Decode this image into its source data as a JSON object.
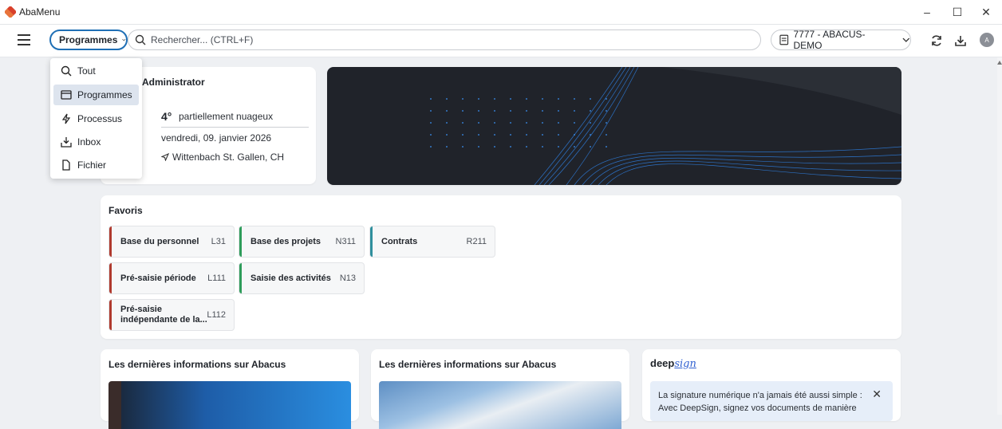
{
  "titlebar": {
    "app_title": "AbaMenu",
    "minimize": "–",
    "maximize": "☐",
    "close": "✕"
  },
  "toolbar": {
    "programmes_label": "Programmes",
    "search_placeholder": "Rechercher... (CTRL+F)",
    "company_label": "7777 - ABACUS-DEMO",
    "avatar_initial": "A"
  },
  "menu": {
    "items": [
      {
        "label": "Tout",
        "icon": "search-icon"
      },
      {
        "label": "Programmes",
        "icon": "window-icon",
        "active": true
      },
      {
        "label": "Processus",
        "icon": "bolt-icon"
      },
      {
        "label": "Inbox",
        "icon": "inbox-icon"
      },
      {
        "label": "Fichier",
        "icon": "file-icon"
      }
    ]
  },
  "welcome": {
    "name": "Administrator",
    "temperature": "4°",
    "weather": "partiellement nuageux",
    "date": "vendredi, 09. janvier 2026",
    "location": "Wittenbach St. Gallen, CH"
  },
  "favorites": {
    "title": "Favoris",
    "items": [
      {
        "label": "Base du personnel",
        "code": "L31",
        "color": "#b03a2e"
      },
      {
        "label": "Base des projets",
        "code": "N311",
        "color": "#2e9c5a"
      },
      {
        "label": "Contrats",
        "code": "R211",
        "color": "#2f8f9d"
      },
      {
        "label": "Pré-saisie période",
        "code": "L111",
        "color": "#b03a2e"
      },
      {
        "label": "Saisie des activités",
        "code": "N13",
        "color": "#2e9c5a"
      },
      {
        "label_line1": "Pré-saisie",
        "label_line2": "indépendante de la...",
        "code": "L112",
        "color": "#b03a2e"
      }
    ]
  },
  "news": [
    {
      "title": "Les dernières informations sur Abacus"
    },
    {
      "title": "Les dernières informations sur Abacus"
    }
  ],
  "deepsign": {
    "title_prefix": "deep",
    "title_script": "sign",
    "notice_line1": "La signature numérique n'a jamais été aussi simple :",
    "notice_line2": "Avec DeepSign, signez vos documents de manière",
    "close": "✕"
  },
  "colors": {
    "accent": "#1f6fb5",
    "banner_bg": "#20232a",
    "banner_lines": "#2f7fe0"
  }
}
